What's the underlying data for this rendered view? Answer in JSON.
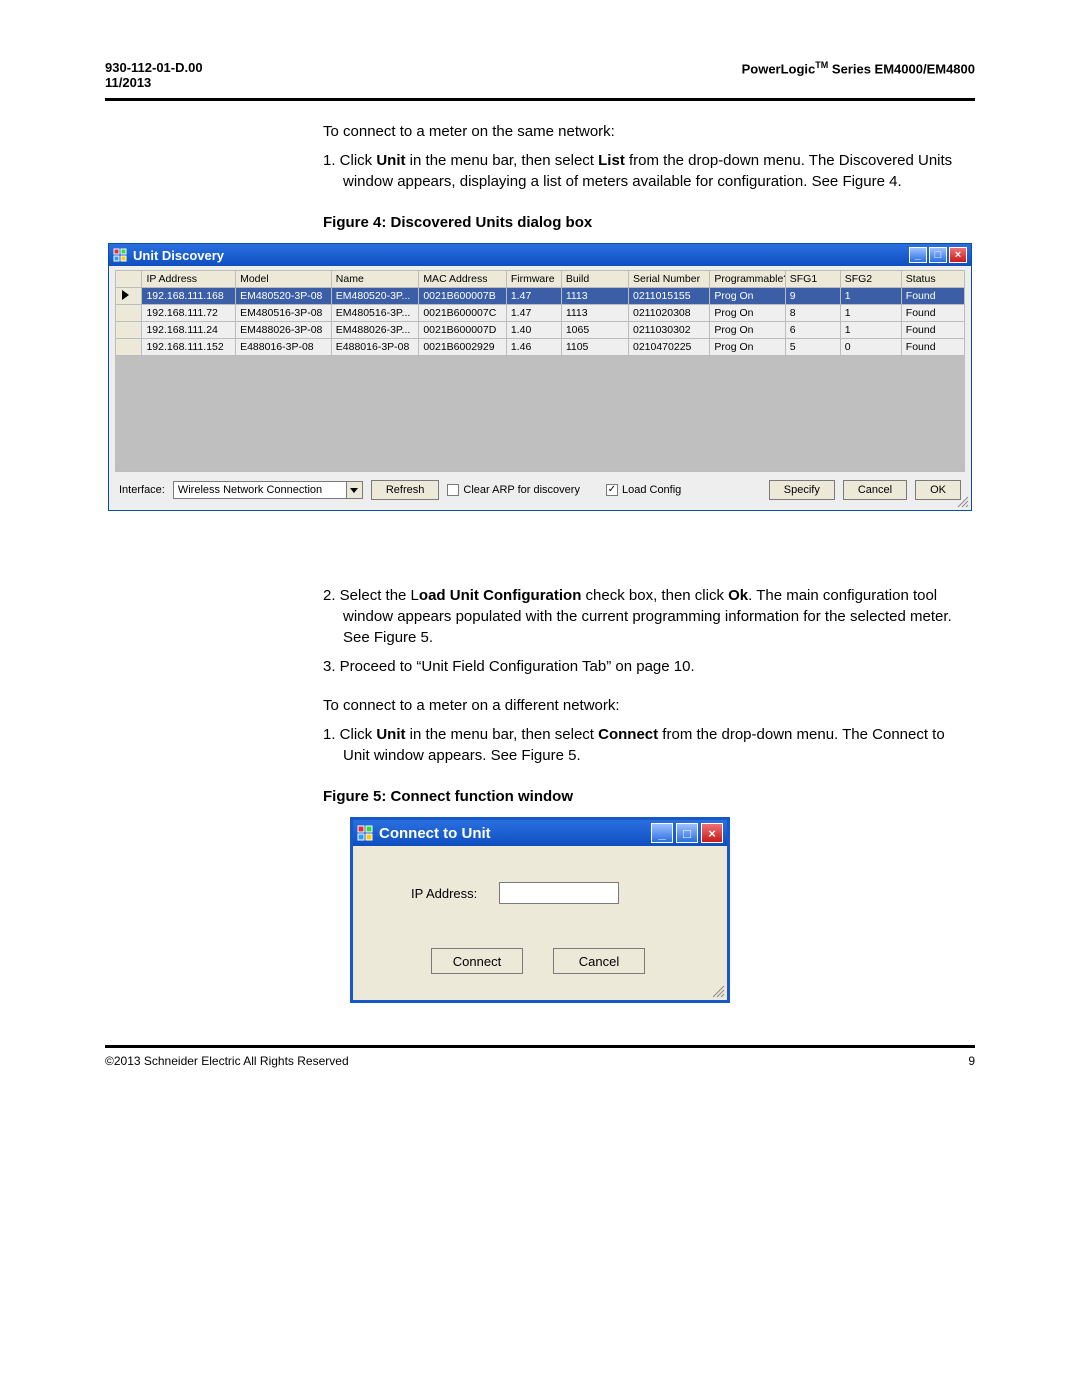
{
  "header": {
    "left_line1": "930-112-01-D.00",
    "left_line2": "11/2013",
    "right_brand_pre": "PowerLogic",
    "right_brand_tm": "TM",
    "right_brand_post": " Series EM4000/EM4800"
  },
  "intro_same_net": "To connect to a meter on the same network:",
  "step1_same_pre": "1.  Click ",
  "step1_same_unit": "Unit",
  "step1_same_mid": " in the menu bar, then select ",
  "step1_same_list": "List",
  "step1_same_post": " from the drop-down menu. The Discovered Units window appears, displaying a list of meters available for configuration. See Figure 4.",
  "fig4_caption": "Figure 4:  Discovered Units dialog box",
  "discovery": {
    "title": "Unit Discovery",
    "columns": [
      "IP Address",
      "Model",
      "Name",
      "MAC Address",
      "Firmware",
      "Build",
      "Serial Number",
      "Programmable?",
      "SFG1",
      "SFG2",
      "Status"
    ],
    "rows": [
      {
        "ip": "192.168.111.168",
        "model": "EM480520-3P-08",
        "name": "EM480520-3P...",
        "mac": "0021B600007B",
        "fw": "1.47",
        "build": "1113",
        "serial": "0211015155",
        "prog": "Prog On",
        "sfg1": "9",
        "sfg2": "1",
        "status": "Found",
        "selected": true
      },
      {
        "ip": "192.168.111.72",
        "model": "EM480516-3P-08",
        "name": "EM480516-3P...",
        "mac": "0021B600007C",
        "fw": "1.47",
        "build": "1113",
        "serial": "0211020308",
        "prog": "Prog On",
        "sfg1": "8",
        "sfg2": "1",
        "status": "Found",
        "selected": false
      },
      {
        "ip": "192.168.111.24",
        "model": "EM488026-3P-08",
        "name": "EM488026-3P...",
        "mac": "0021B600007D",
        "fw": "1.40",
        "build": "1065",
        "serial": "0211030302",
        "prog": "Prog On",
        "sfg1": "6",
        "sfg2": "1",
        "status": "Found",
        "selected": false
      },
      {
        "ip": "192.168.111.152",
        "model": "E488016-3P-08",
        "name": "E488016-3P-08",
        "mac": "0021B6002929",
        "fw": "1.46",
        "build": "1105",
        "serial": "0210470225",
        "prog": "Prog On",
        "sfg1": "5",
        "sfg2": "0",
        "status": "Found",
        "selected": false
      }
    ],
    "bottom": {
      "interface_label": "Interface:",
      "interface_value": "Wireless Network Connection",
      "refresh": "Refresh",
      "clear_arp_label": "Clear ARP for discovery",
      "clear_arp_checked": false,
      "load_config_label": "Load Config",
      "load_config_checked": true,
      "specify": "Specify",
      "cancel": "Cancel",
      "ok": "OK"
    }
  },
  "step2_pre": "2.  Select the L",
  "step2_b": "oad Unit Configuration",
  "step2_mid": " check box, then click ",
  "step2_ok": "Ok",
  "step2_post": ". The main configuration tool window appears populated with the current programming information for the selected meter. See Figure 5.",
  "step3": "3.  Proceed to “Unit Field Configuration Tab” on page 10.",
  "intro_diff_net": "To connect to a meter on a different network:",
  "step1_diff_pre": "1.  Click ",
  "step1_diff_unit": "Unit",
  "step1_diff_mid": " in the menu bar, then select ",
  "step1_diff_connect": "Connect",
  "step1_diff_post": " from the drop-down menu. The Connect to Unit window appears. See Figure 5.",
  "fig5_caption": "Figure 5:  Connect function window",
  "connect_win": {
    "title": "Connect to Unit",
    "ip_label": "IP Address:",
    "ip_value": "",
    "connect_btn": "Connect",
    "cancel_btn": "Cancel"
  },
  "footer": {
    "left": "©2013 Schneider Electric All Rights Reserved",
    "right": "9"
  }
}
